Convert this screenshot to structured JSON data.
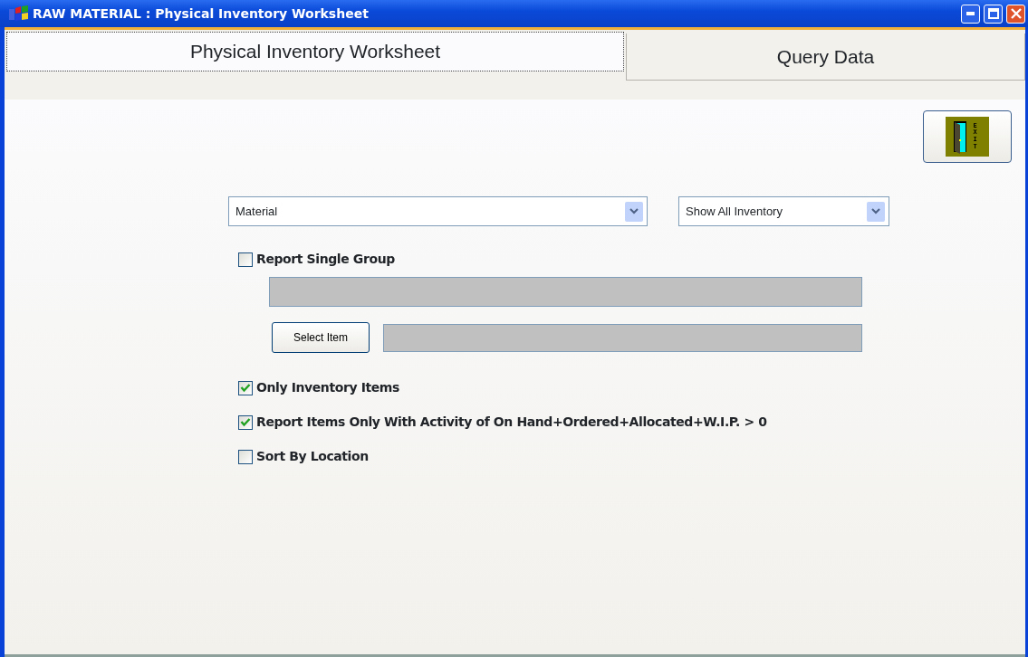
{
  "window": {
    "title": "RAW MATERIAL : Physical Inventory Worksheet"
  },
  "tabs": [
    {
      "label": "Physical Inventory Worksheet",
      "selected": true
    },
    {
      "label": "Query Data",
      "selected": false
    }
  ],
  "exit_button": {
    "icon_text": "EXIT"
  },
  "dropdowns": [
    {
      "value": "Material"
    },
    {
      "value": "Show All Inventory"
    }
  ],
  "report_single_group": {
    "label": "Report Single Group",
    "checked": false
  },
  "group_field": {
    "disabled": true
  },
  "select_item": {
    "button": "Select Item",
    "field_disabled": true
  },
  "options": [
    {
      "label": "Only Inventory Items",
      "checked": true
    },
    {
      "label": "Report Items Only With Activity of On Hand+Ordered+Allocated+W.I.P. > 0",
      "checked": true
    },
    {
      "label": "Sort By Location",
      "checked": false
    }
  ]
}
